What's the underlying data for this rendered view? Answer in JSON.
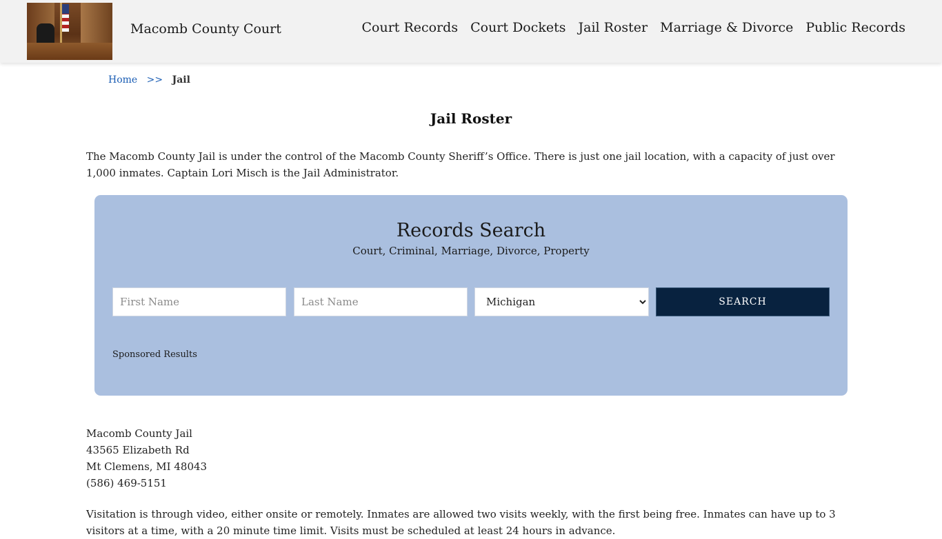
{
  "header": {
    "site_title": "Macomb County Court",
    "logo_alt": "courtroom-image",
    "nav": [
      "Court Records",
      "Court Dockets",
      "Jail Roster",
      "Marriage & Divorce",
      "Public Records"
    ]
  },
  "breadcrumb": {
    "home": "Home",
    "separator": ">>",
    "current": "Jail"
  },
  "page": {
    "title": "Jail Roster",
    "intro": "The Macomb County Jail is under the control of the Macomb County Sheriff’s Office. There is just one jail location, with a capacity of just over 1,000 inmates. Captain Lori Misch is the Jail Administrator."
  },
  "search": {
    "title": "Records Search",
    "subtitle": "Court, Criminal, Marriage, Divorce, Property",
    "first_name_placeholder": "First Name",
    "last_name_placeholder": "Last Name",
    "state_selected": "Michigan",
    "button_label": "SEARCH",
    "sponsored": "Sponsored Results",
    "background_color": "#aabfdf",
    "button_color": "#08223f"
  },
  "address": {
    "name": "Macomb County Jail",
    "street": "43565 Elizabeth Rd",
    "city": "Mt Clemens, MI 48043",
    "phone": "(586) 469-5151"
  },
  "visitation": "Visitation is through video, either onsite or remotely. Inmates are allowed two visits weekly, with the first being free. Inmates can have up to 3 visitors at a time, with a 20 minute time limit. Visits must be scheduled at least 24 hours in advance."
}
